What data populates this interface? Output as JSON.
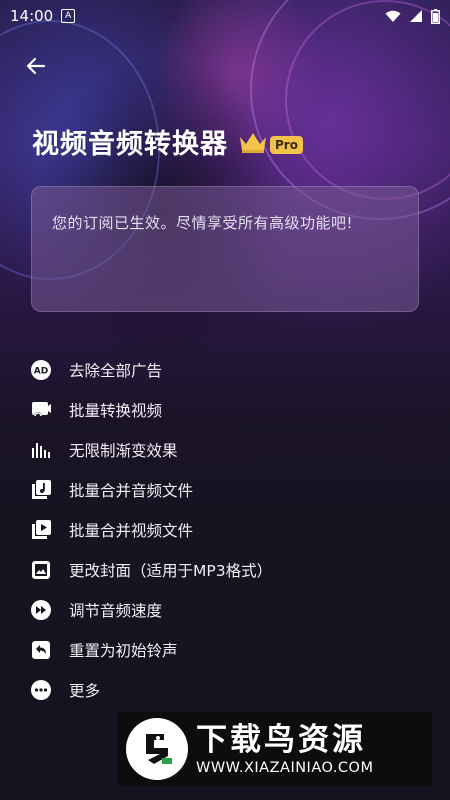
{
  "status_bar": {
    "time": "14:00",
    "notification_icon": "A"
  },
  "header": {
    "title": "视频音频转换器",
    "pro_badge": "Pro"
  },
  "subscription_card": {
    "message": "您的订阅已生效。尽情享受所有高级功能吧!"
  },
  "features": [
    {
      "label": "去除全部广告",
      "icon": "ad-icon"
    },
    {
      "label": "批量转换视频",
      "icon": "video-convert-icon"
    },
    {
      "label": "无限制渐变效果",
      "icon": "equalizer-icon"
    },
    {
      "label": "批量合并音频文件",
      "icon": "music-file-icon"
    },
    {
      "label": "批量合并视频文件",
      "icon": "video-file-icon"
    },
    {
      "label": "更改封面（适用于MP3格式）",
      "icon": "image-icon"
    },
    {
      "label": "调节音频速度",
      "icon": "fast-forward-icon"
    },
    {
      "label": "重置为初始铃声",
      "icon": "reset-icon"
    },
    {
      "label": "更多",
      "icon": "more-icon"
    }
  ],
  "watermark": {
    "title": "下载鸟资源",
    "url": "WWW.XIAZAINIAO.COM"
  },
  "colors": {
    "crown": "#f3c24a",
    "background": "#171320"
  }
}
